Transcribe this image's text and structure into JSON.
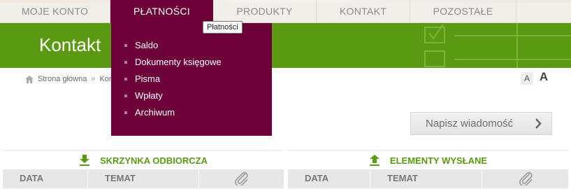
{
  "nav": {
    "items": [
      {
        "label": "MOJE KONTO"
      },
      {
        "label": "PŁATNOŚCI"
      },
      {
        "label": "PRODUKTY"
      },
      {
        "label": "KONTAKT"
      },
      {
        "label": "POZOSTAŁE"
      }
    ]
  },
  "banner": {
    "title": "Kontakt"
  },
  "breadcrumb": {
    "home": "Strona główna",
    "separator": "»",
    "current": "Kon"
  },
  "font_size": {
    "small": "A",
    "large": "A"
  },
  "tooltip": "Płatności",
  "dropdown": {
    "items": [
      {
        "label": "Saldo"
      },
      {
        "label": "Dokumenty księgowe"
      },
      {
        "label": "Pisma"
      },
      {
        "label": "Wpłaty"
      },
      {
        "label": "Archiwum"
      }
    ]
  },
  "compose_button": {
    "label": "Napisz wiadomość",
    "icon": "chevron-right-icon"
  },
  "inbox": {
    "title": "SKRZYNKA ODBIORCZA",
    "icon": "download-icon",
    "columns": [
      "DATA",
      "TEMAT"
    ],
    "attachment_icon": "paperclip-icon"
  },
  "sent": {
    "title": "ELEMENTY WYSŁANE",
    "icon": "upload-icon",
    "columns": [
      "DATA",
      "TEMAT"
    ],
    "attachment_icon": "paperclip-icon"
  },
  "colors": {
    "brand_green": "#5a9a12",
    "menu_purple": "#6d0038"
  }
}
